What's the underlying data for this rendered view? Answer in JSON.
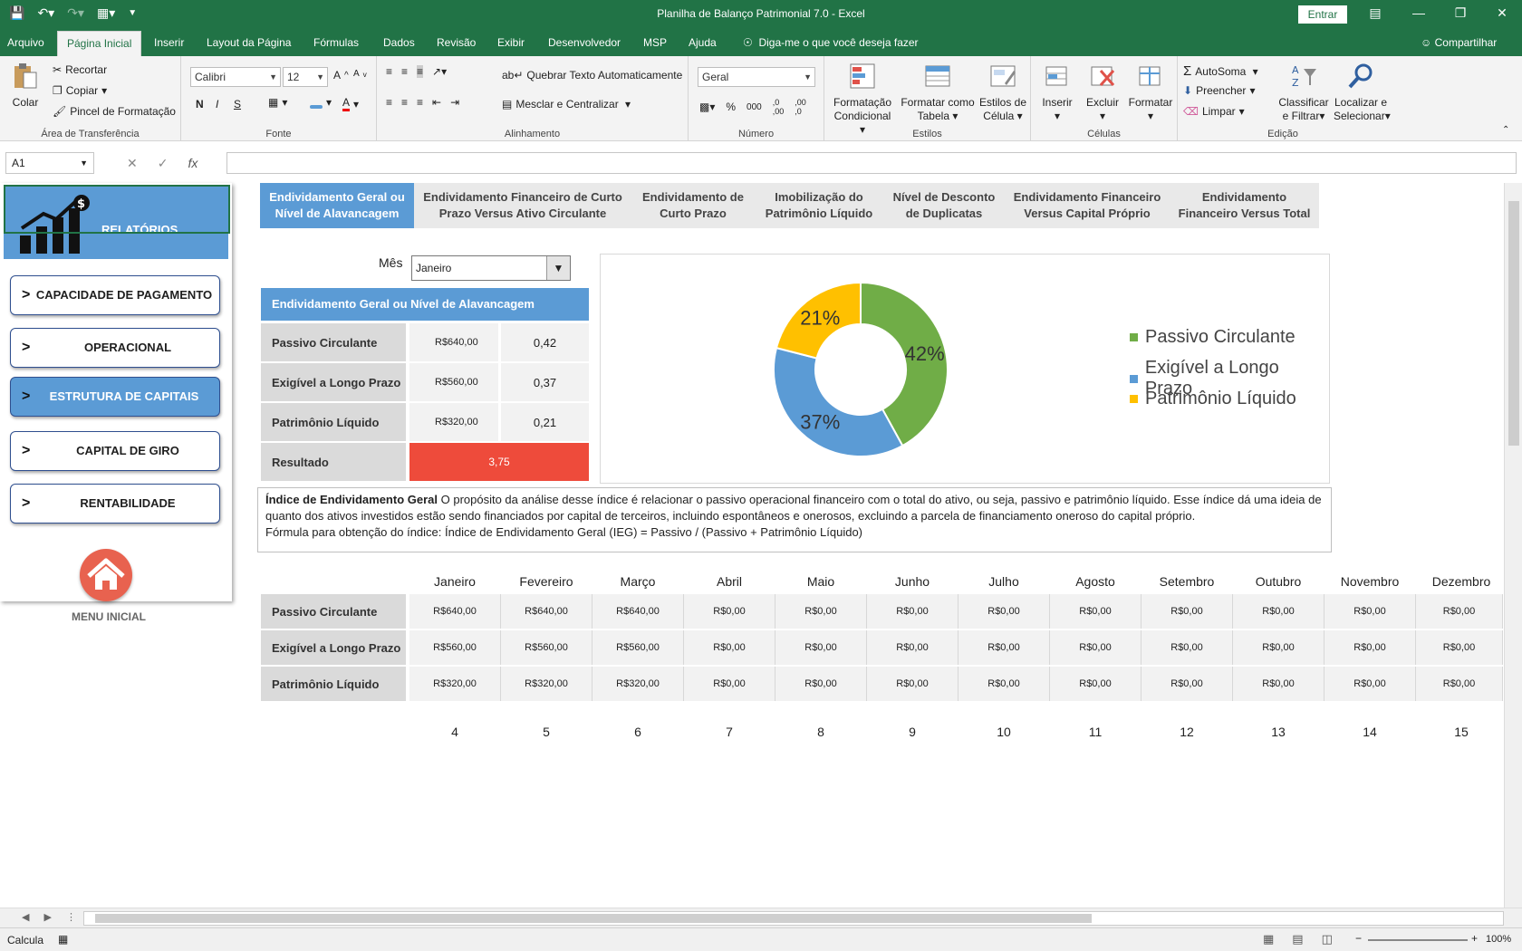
{
  "titlebar": {
    "title": "Planilha de Balanço Patrimonial 7.0  -  Excel",
    "signin": "Entrar"
  },
  "tabs": [
    "Arquivo",
    "Página Inicial",
    "Inserir",
    "Layout da Página",
    "Fórmulas",
    "Dados",
    "Revisão",
    "Exibir",
    "Desenvolvedor",
    "MSP",
    "Ajuda"
  ],
  "tellme": "Diga-me o que você deseja fazer",
  "share": "Compartilhar",
  "ribbon": {
    "clipboard": {
      "paste": "Colar",
      "cut": "Recortar",
      "copy": "Copiar",
      "painter": "Pincel de Formatação",
      "group": "Área de Transferência"
    },
    "font": {
      "name": "Calibri",
      "size": "12",
      "bold": "N",
      "italic": "I",
      "underline": "S",
      "group": "Fonte"
    },
    "alignment": {
      "wrap": "Quebrar Texto Automaticamente",
      "merge": "Mesclar e Centralizar",
      "group": "Alinhamento"
    },
    "number": {
      "format": "Geral",
      "group": "Número"
    },
    "styles": {
      "cond1": "Formatação",
      "cond2": "Condicional",
      "table1": "Formatar como",
      "table2": "Tabela",
      "cell1": "Estilos de",
      "cell2": "Célula",
      "group": "Estilos"
    },
    "cells": {
      "insert": "Inserir",
      "delete": "Excluir",
      "format": "Formatar",
      "group": "Células"
    },
    "editing": {
      "autosum": "AutoSoma",
      "fill": "Preencher",
      "clear": "Limpar",
      "sort1": "Classificar",
      "sort2": "e Filtrar",
      "find1": "Localizar e",
      "find2": "Selecionar",
      "group": "Edição"
    }
  },
  "formula": {
    "cell": "A1",
    "fx": "fx",
    "value": ""
  },
  "sidebar": {
    "header": "RELATÓRIOS",
    "buttons": [
      "CAPACIDADE DE PAGAMENTO",
      "OPERACIONAL",
      "ESTRUTURA DE CAPITAIS",
      "CAPITAL DE GIRO",
      "RENTABILIDADE"
    ],
    "arrow": ">",
    "home_label": "MENU INICIAL"
  },
  "report_tabs": [
    {
      "l1": "Endividamento Geral ou",
      "l2": "Nível de Alavancagem"
    },
    {
      "l1": "Endividamento Financeiro de Curto",
      "l2": "Prazo Versus Ativo Circulante"
    },
    {
      "l1": "Endividamento de",
      "l2": "Curto Prazo"
    },
    {
      "l1": "Imobilização do",
      "l2": "Patrimônio Líquido"
    },
    {
      "l1": "Nível de Desconto",
      "l2": "de Duplicatas"
    },
    {
      "l1": "Endividamento Financeiro",
      "l2": "Versus Capital Próprio"
    },
    {
      "l1": "Endividamento",
      "l2": "Financeiro Versus Total"
    }
  ],
  "month": {
    "label": "Mês",
    "selected": "Janeiro"
  },
  "summary": {
    "title": "Endividamento Geral ou Nível de Alavancagem",
    "rows": [
      {
        "label": "Passivo Circulante",
        "value": "R$640,00",
        "ratio": "0,42"
      },
      {
        "label": "Exigível a Longo Prazo",
        "value": "R$560,00",
        "ratio": "0,37"
      },
      {
        "label": "Patrimônio Líquido",
        "value": "R$320,00",
        "ratio": "0,21"
      }
    ],
    "result_label": "Resultado",
    "result_value": "3,75"
  },
  "chart_data": {
    "type": "pie",
    "donut": true,
    "categories": [
      "Passivo Circulante",
      "Exigível a Longo Prazo",
      "Patrimônio Líquido"
    ],
    "values": [
      42,
      37,
      21
    ],
    "labels": [
      "42%",
      "37%",
      "21%"
    ],
    "colors": [
      "#70ad47",
      "#5b9bd5",
      "#ffc000"
    ],
    "legend": "right"
  },
  "description": {
    "bold": "Índice de Endividamento Geral",
    "text": " O propósito da análise desse índice é relacionar o passivo operacional financeiro com o total do ativo, ou seja, passivo e patrimônio líquido. Esse índice dá uma ideia de quanto dos ativos investidos estão sendo financiados por capital de terceiros, incluindo espontâneos e onerosos, excluindo a parcela de financiamento oneroso do capital próprio.",
    "formula": "Fórmula para obtenção do índice:  Índice de Endividamento Geral (IEG) = Passivo / (Passivo + Patrimônio Líquido)"
  },
  "monthly": {
    "months": [
      "Janeiro",
      "Fevereiro",
      "Março",
      "Abril",
      "Maio",
      "Junho",
      "Julho",
      "Agosto",
      "Setembro",
      "Outubro",
      "Novembro",
      "Dezembro"
    ],
    "rows": [
      {
        "label": "Passivo Circulante",
        "values": [
          "R$640,00",
          "R$640,00",
          "R$640,00",
          "R$0,00",
          "R$0,00",
          "R$0,00",
          "R$0,00",
          "R$0,00",
          "R$0,00",
          "R$0,00",
          "R$0,00",
          "R$0,00"
        ]
      },
      {
        "label": "Exigível a Longo Prazo",
        "values": [
          "R$560,00",
          "R$560,00",
          "R$560,00",
          "R$0,00",
          "R$0,00",
          "R$0,00",
          "R$0,00",
          "R$0,00",
          "R$0,00",
          "R$0,00",
          "R$0,00",
          "R$0,00"
        ]
      },
      {
        "label": "Patrimônio Líquido",
        "values": [
          "R$320,00",
          "R$320,00",
          "R$320,00",
          "R$0,00",
          "R$0,00",
          "R$0,00",
          "R$0,00",
          "R$0,00",
          "R$0,00",
          "R$0,00",
          "R$0,00",
          "R$0,00"
        ]
      }
    ],
    "numbers": [
      "4",
      "5",
      "6",
      "7",
      "8",
      "9",
      "10",
      "11",
      "12",
      "13",
      "14",
      "15"
    ]
  },
  "status": {
    "mode": "Calcula",
    "zoom": "100%"
  }
}
